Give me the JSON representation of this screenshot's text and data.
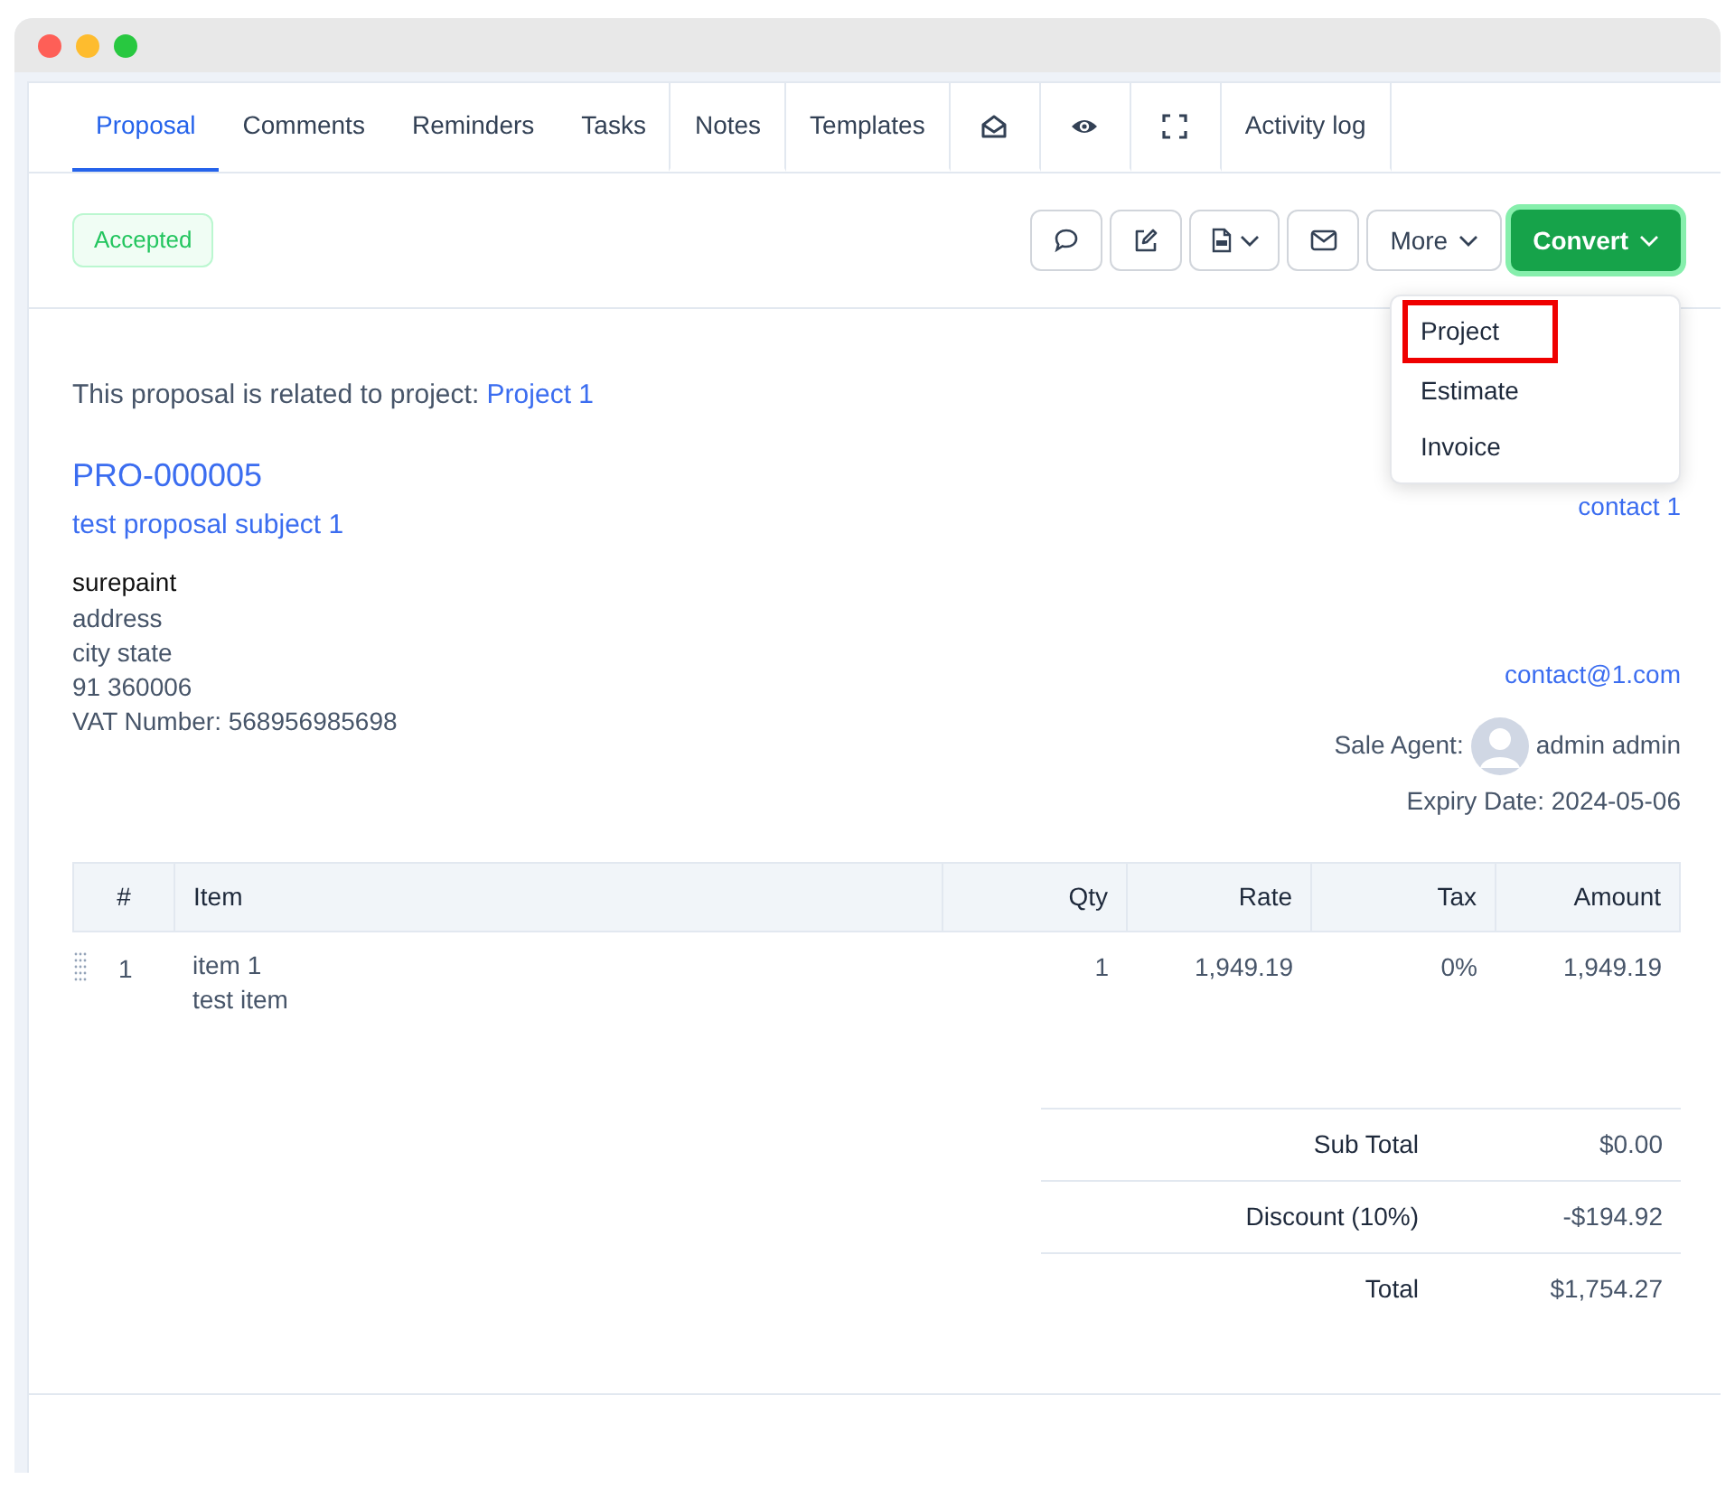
{
  "tabs": [
    {
      "kind": "text",
      "label": "Proposal",
      "selected": true
    },
    {
      "kind": "text",
      "label": "Comments",
      "selected": false
    },
    {
      "kind": "text",
      "label": "Reminders",
      "selected": false
    },
    {
      "kind": "text",
      "label": "Tasks",
      "selected": false
    },
    {
      "kind": "text",
      "label": "Notes",
      "selected": false
    },
    {
      "kind": "text",
      "label": "Templates",
      "selected": false
    },
    {
      "kind": "icon",
      "selected": false
    },
    {
      "kind": "icon",
      "selected": false
    },
    {
      "kind": "icon",
      "selected": false
    },
    {
      "kind": "text",
      "label": "Activity log",
      "selected": false
    }
  ],
  "status_badge": "Accepted",
  "toolbar": [
    {
      "kind": "icon"
    },
    {
      "kind": "icon"
    },
    {
      "kind": "icon_caret"
    },
    {
      "kind": "icon"
    },
    {
      "kind": "menu",
      "label": "More",
      "expanded": false
    },
    {
      "kind": "primary",
      "label": "Convert",
      "expanded": true
    }
  ],
  "convert_menu": [
    {
      "label": "Project",
      "highlighted": true
    },
    {
      "label": "Estimate",
      "highlighted": false
    },
    {
      "label": "Invoice",
      "highlighted": false
    }
  ],
  "related_text": "This proposal is related to project:",
  "related_link": "Project 1",
  "number": "PRO-000005",
  "subject": "test proposal subject 1",
  "company": "surepaint",
  "address_lines": [
    "address",
    "city state",
    "91 360006",
    "VAT Number: 568956985698"
  ],
  "contact_name": "contact 1",
  "contact_email": "contact@1.com",
  "sale_agent_label": "Sale Agent:",
  "sale_agent": "admin admin",
  "expiry": "Expiry Date: 2024-05-06",
  "table": {
    "columns": [
      "#",
      "Item",
      "Qty",
      "Rate",
      "Tax",
      "Amount"
    ],
    "rows": [
      {
        "number": "1",
        "item": "item 1",
        "description": "test item",
        "qty": "1",
        "rate": "1,949.19",
        "tax": "0%",
        "amount": "1,949.19"
      }
    ]
  },
  "totals": [
    {
      "label": "Sub Total",
      "value": "$0.00"
    },
    {
      "label": "Discount (10%)",
      "value": "-$194.92"
    },
    {
      "label": "Total",
      "value": "$1,754.27"
    }
  ]
}
